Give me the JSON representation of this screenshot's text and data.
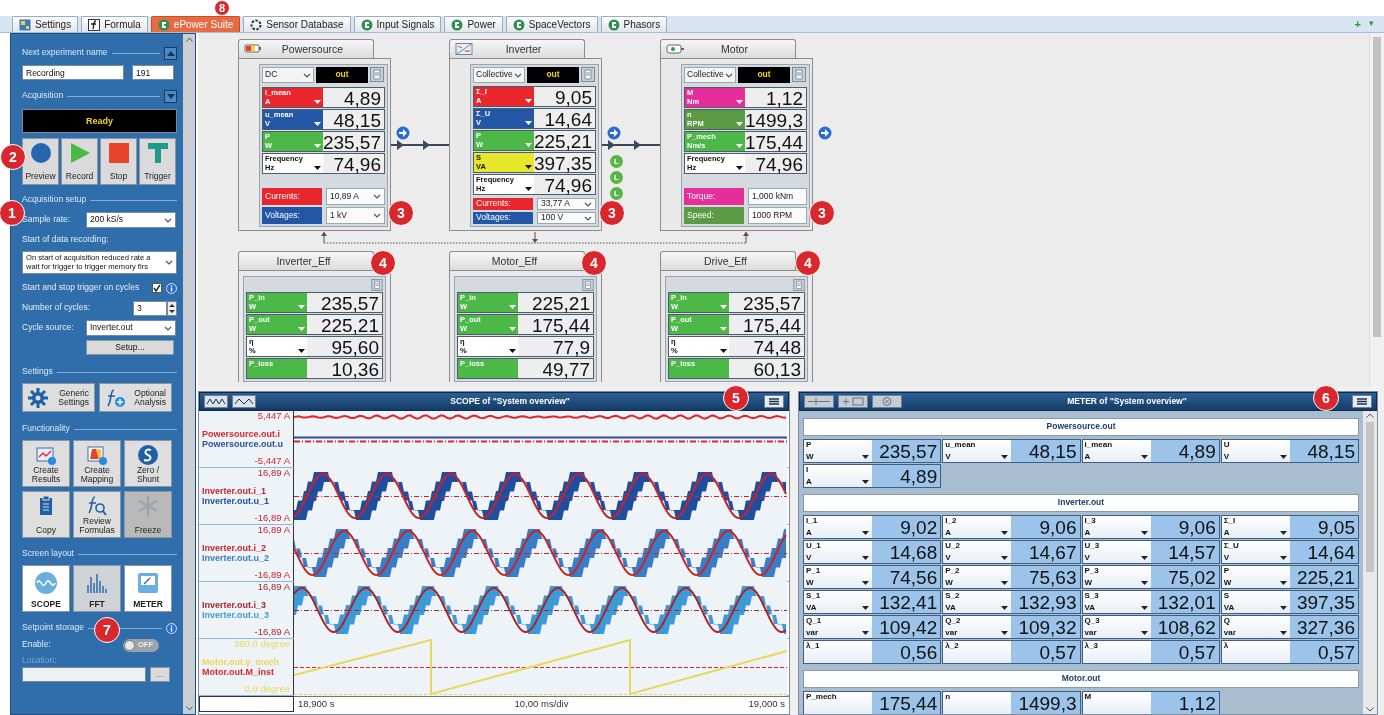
{
  "tabs": [
    {
      "label": "Settings",
      "kind": "settings",
      "selected": false
    },
    {
      "label": "Formula",
      "kind": "formula",
      "selected": false
    },
    {
      "label": "ePower Suite",
      "kind": "epower",
      "selected": true
    },
    {
      "label": "Sensor Database",
      "kind": "sensor",
      "selected": false
    },
    {
      "label": "Input Signals",
      "kind": "epower",
      "selected": false
    },
    {
      "label": "Power",
      "kind": "epower",
      "selected": false
    },
    {
      "label": "SpaceVectors",
      "kind": "epower",
      "selected": false
    },
    {
      "label": "Phasors",
      "kind": "epower",
      "selected": false
    }
  ],
  "tab_actions": [
    "+",
    "▾"
  ],
  "sidebar": {
    "experiment": {
      "title": "Next experiment name",
      "expanded": true,
      "name": "Recording",
      "number": "191"
    },
    "acquisition": {
      "title": "Acquisition",
      "expanded": false,
      "status": "Ready",
      "buttons": [
        {
          "label": "Preview",
          "kind": "preview"
        },
        {
          "label": "Record",
          "kind": "record"
        },
        {
          "label": "Stop",
          "kind": "stop"
        },
        {
          "label": "Trigger",
          "kind": "trigger"
        }
      ]
    },
    "setup": {
      "title": "Acquisition setup",
      "sample_rate_label": "Sample rate:",
      "sample_rate": "200 kS/s",
      "start_label": "Start of data recording:",
      "start_lines": [
        "On start of acquisition reduced rate a",
        "wait for trigger to trigger memory firs"
      ],
      "cycles_trigger_label": "Start and stop trigger on cycles",
      "cycles_trigger_checked": true,
      "cycles_label": "Number of cycles:",
      "cycles": "3",
      "source_label": "Cycle source:",
      "source": "Inverter.out",
      "setup_button": "Setup..."
    },
    "settings": {
      "title": "Settings",
      "buttons": [
        {
          "label": "Generic Settings",
          "kind": "gear"
        },
        {
          "label": "Optional Analysis",
          "kind": "function"
        }
      ]
    },
    "functionality": {
      "title": "Functionality",
      "buttons": [
        {
          "label": "Create Results",
          "kind": "results",
          "pressed": false
        },
        {
          "label": "Create Mapping",
          "kind": "mapping",
          "pressed": false
        },
        {
          "label": "Zero / Shunt",
          "kind": "shunt",
          "pressed": false
        },
        {
          "label": "Copy",
          "kind": "copy",
          "pressed": false
        },
        {
          "label": "Review Formulas",
          "kind": "review",
          "pressed": false
        },
        {
          "label": "Freeze",
          "kind": "freeze",
          "pressed": true
        }
      ]
    },
    "layout": {
      "title": "Screen layout",
      "buttons": [
        {
          "label": "SCOPE",
          "kind": "scope",
          "selected": true
        },
        {
          "label": "FFT",
          "kind": "fft",
          "selected": false
        },
        {
          "label": "METER",
          "kind": "meter",
          "selected": true
        }
      ]
    },
    "setpoint": {
      "title": "Setpoint storage",
      "enable_label": "Enable:",
      "enabled": false,
      "toggle_text": "OFF",
      "location_label": "Location:",
      "browse_button": "..."
    }
  },
  "diagram": {
    "blocks": [
      {
        "title": "Powersource",
        "kind": "source",
        "mode": "DC",
        "output": "out",
        "rows": [
          {
            "name": "i_mean",
            "unit": "A",
            "value": "4,89",
            "color": "#e8262b"
          },
          {
            "name": "u_mean",
            "unit": "V",
            "value": "48,15",
            "color": "#2456a6"
          },
          {
            "name": "P",
            "unit": "W",
            "value": "235,57",
            "color": "#4cb848"
          },
          {
            "name": "Frequency",
            "unit": "Hz",
            "value": "74,96",
            "color": "#ffffff"
          }
        ],
        "settings": [
          {
            "label": "Currents:",
            "value": "10,89 A",
            "color": "#e8262b",
            "kind": "select"
          },
          {
            "label": "Voltages:",
            "value": "1 kV",
            "color": "#2456a6",
            "kind": "select"
          }
        ]
      },
      {
        "title": "Inverter",
        "kind": "inverter",
        "mode": "Collective",
        "output": "out",
        "badges": [
          "L",
          "L",
          "L"
        ],
        "rows": [
          {
            "name": "Σ_I",
            "unit": "A",
            "value": "9,05",
            "color": "#e8262b"
          },
          {
            "name": "Σ_U",
            "unit": "V",
            "value": "14,64",
            "color": "#2456a6"
          },
          {
            "name": "P",
            "unit": "W",
            "value": "225,21",
            "color": "#4cb848"
          },
          {
            "name": "S",
            "unit": "VA",
            "value": "397,35",
            "color": "#e6e62a"
          },
          {
            "name": "Frequency",
            "unit": "Hz",
            "value": "74,96",
            "color": "#ffffff"
          }
        ],
        "settings": [
          {
            "label": "Currents:",
            "value": "33,77 A",
            "color": "#e8262b",
            "kind": "select"
          },
          {
            "label": "Voltages:",
            "value": "100 V",
            "color": "#2456a6",
            "kind": "select"
          }
        ]
      },
      {
        "title": "Motor",
        "kind": "motor",
        "mode": "Collective",
        "output": "out",
        "rows": [
          {
            "name": "M",
            "unit": "Nm",
            "value": "1,12",
            "color": "#e62e9a"
          },
          {
            "name": "n",
            "unit": "RPM",
            "value": "1499,3",
            "color": "#5b9b45"
          },
          {
            "name": "P_mech",
            "unit": "Nm/s",
            "value": "175,44",
            "color": "#4cb848"
          },
          {
            "name": "Frequency",
            "unit": "Hz",
            "value": "74,96",
            "color": "#ffffff"
          }
        ],
        "settings": [
          {
            "label": "Torque:",
            "value": "1,000 kNm",
            "color": "#e62e9a",
            "kind": "input"
          },
          {
            "label": "Speed:",
            "value": "1000 RPM",
            "color": "#5b9b45",
            "kind": "input"
          }
        ]
      }
    ],
    "efficiency_blocks": [
      {
        "title": "Inverter_Eff",
        "rows": [
          {
            "name": "P_in",
            "unit": "W",
            "value": "235,57",
            "color": "#4cb848"
          },
          {
            "name": "P_out",
            "unit": "W",
            "value": "225,21",
            "color": "#4cb848"
          },
          {
            "name": "η",
            "unit": "%",
            "value": "95,60",
            "color": "#ffffff"
          },
          {
            "name": "P_loss",
            "value": "10,36",
            "color": "#4cb848"
          }
        ]
      },
      {
        "title": "Motor_Eff",
        "rows": [
          {
            "name": "P_in",
            "unit": "W",
            "value": "225,21",
            "color": "#4cb848"
          },
          {
            "name": "P_out",
            "unit": "W",
            "value": "175,44",
            "color": "#4cb848"
          },
          {
            "name": "η",
            "unit": "%",
            "value": "77,9",
            "color": "#ffffff"
          },
          {
            "name": "P_loss",
            "value": "49,77",
            "color": "#4cb848"
          }
        ]
      },
      {
        "title": "Drive_Eff",
        "rows": [
          {
            "name": "P_in",
            "unit": "W",
            "value": "235,57",
            "color": "#4cb848"
          },
          {
            "name": "P_out",
            "unit": "W",
            "value": "175,44",
            "color": "#4cb848"
          },
          {
            "name": "η",
            "unit": "%",
            "value": "74,48",
            "color": "#ffffff"
          },
          {
            "name": "P_loss",
            "value": "60,13",
            "color": "#4cb848"
          }
        ]
      }
    ]
  },
  "scope": {
    "title": "SCOPE of \"System overview\"",
    "channels": [
      {
        "max": "5,447  A",
        "min": "-5,447  A",
        "kind": "dc",
        "signals": [
          {
            "name": "Powersource.out.i",
            "color": "#e0262b"
          },
          {
            "name": "Powersource.out.u",
            "color": "#2a4f9e"
          }
        ]
      },
      {
        "max": "16,89  A",
        "min": "-16,89  A",
        "kind": "sine",
        "signals": [
          {
            "name": "Inverter.out.i_1",
            "color": "#c8242b"
          },
          {
            "name": "Inverter.out.u_1",
            "color": "#1f4e9e"
          }
        ]
      },
      {
        "max": "16,89  A",
        "min": "-16,89  A",
        "kind": "sine",
        "signals": [
          {
            "name": "Inverter.out.i_2",
            "color": "#c8242b"
          },
          {
            "name": "Inverter.out.u_2",
            "color": "#3a7cc6"
          }
        ]
      },
      {
        "max": "16,89  A",
        "min": "-16,89  A",
        "kind": "sine",
        "signals": [
          {
            "name": "Inverter.out.i_3",
            "color": "#a8262b"
          },
          {
            "name": "Inverter.out.u_3",
            "color": "#3d9ad8"
          }
        ]
      },
      {
        "max": "360,0  degree",
        "min": "0,0  degree",
        "kind": "ramp",
        "signals": [
          {
            "name": "Motor.out.γ_mech",
            "color": "#e8d85a"
          },
          {
            "name": "Motor.out.M_inst",
            "color": "#e0262b"
          }
        ]
      }
    ],
    "axis": [
      "18,900 s",
      "10,00 ms/div",
      "19,000 s"
    ]
  },
  "meter": {
    "title": "METER of \"System overview\"",
    "sections": [
      {
        "title": "Powersource.out",
        "cells": [
          {
            "name": "P",
            "unit": "W",
            "value": "235,57"
          },
          {
            "name": "u_mean",
            "unit": "V",
            "value": "48,15"
          },
          {
            "name": "i_mean",
            "unit": "A",
            "value": "4,89"
          },
          {
            "name": "U",
            "unit": "V",
            "value": "48,15"
          },
          {
            "name": "I",
            "unit": "A",
            "value": "4,89"
          }
        ]
      },
      {
        "title": "Inverter.out",
        "cells": [
          {
            "name": "I_1",
            "unit": "A",
            "value": "9,02"
          },
          {
            "name": "I_2",
            "unit": "A",
            "value": "9,06"
          },
          {
            "name": "I_3",
            "unit": "A",
            "value": "9,06"
          },
          {
            "name": "Σ_I",
            "unit": "A",
            "value": "9,05"
          },
          {
            "name": "U_1",
            "unit": "V",
            "value": "14,68"
          },
          {
            "name": "U_2",
            "unit": "V",
            "value": "14,67"
          },
          {
            "name": "U_3",
            "unit": "V",
            "value": "14,57"
          },
          {
            "name": "Σ_U",
            "unit": "V",
            "value": "14,64"
          },
          {
            "name": "P_1",
            "unit": "W",
            "value": "74,56"
          },
          {
            "name": "P_2",
            "unit": "W",
            "value": "75,63"
          },
          {
            "name": "P_3",
            "unit": "W",
            "value": "75,02"
          },
          {
            "name": "P",
            "unit": "W",
            "value": "225,21"
          },
          {
            "name": "S_1",
            "unit": "VA",
            "value": "132,41"
          },
          {
            "name": "S_2",
            "unit": "VA",
            "value": "132,93"
          },
          {
            "name": "S_3",
            "unit": "VA",
            "value": "132,01"
          },
          {
            "name": "S",
            "unit": "VA",
            "value": "397,35"
          },
          {
            "name": "Q_1",
            "unit": "var",
            "value": "109,42"
          },
          {
            "name": "Q_2",
            "unit": "var",
            "value": "109,32"
          },
          {
            "name": "Q_3",
            "unit": "var",
            "value": "108,62"
          },
          {
            "name": "Q",
            "unit": "var",
            "value": "327,36"
          },
          {
            "name": "λ_1",
            "value": "0,56"
          },
          {
            "name": "λ_2",
            "value": "0,57"
          },
          {
            "name": "λ_3",
            "value": "0,57"
          },
          {
            "name": "λ",
            "value": "0,57"
          }
        ]
      },
      {
        "title": "Motor.out",
        "cells": [
          {
            "name": "P_mech",
            "value": "175,44"
          },
          {
            "name": "n",
            "value": "1499,3"
          },
          {
            "name": "M",
            "value": "1,12"
          }
        ]
      }
    ]
  },
  "callouts": [
    "8",
    "2",
    "1",
    "3",
    "3",
    "3",
    "4",
    "4",
    "4",
    "5",
    "6",
    "7"
  ]
}
